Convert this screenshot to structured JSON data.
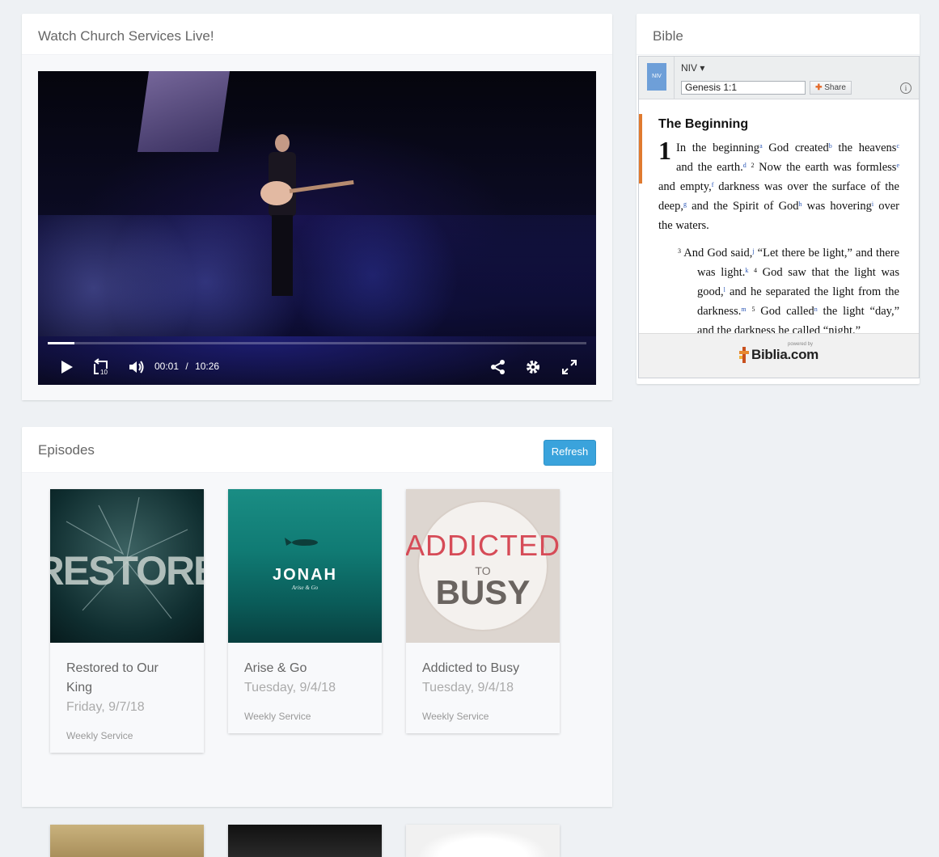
{
  "video_panel": {
    "title": "Watch Church Services Live!",
    "progress": 0.05,
    "current_time": "00:01",
    "separator": "/",
    "duration": "10:26",
    "rewind_label": "10"
  },
  "bible_panel": {
    "title": "Bible",
    "logo_label": "NIV",
    "version": "NIV ▾",
    "reference": "Genesis 1:1",
    "share_label": "Share",
    "info_label": "i",
    "heading": "The Beginning",
    "chapter": "1",
    "powered_by": "powered by",
    "brand": "Biblia.com"
  },
  "episodes_panel": {
    "title": "Episodes",
    "refresh_label": "Refresh",
    "cards": [
      {
        "title": "Restored to Our King",
        "date": "Friday, 9/7/18",
        "type": "Weekly Service",
        "art": "RESTORE"
      },
      {
        "title": "Arise & Go",
        "date": "Tuesday, 9/4/18",
        "type": "Weekly Service",
        "art": "JONAH",
        "art_sub": "Arise & Go"
      },
      {
        "title": "Addicted to Busy",
        "date": "Tuesday, 9/4/18",
        "type": "Weekly Service",
        "art": "ADDICTED",
        "art_to": "TO",
        "art_busy": "BUSY"
      }
    ]
  },
  "colors": {
    "accent_blue": "#3aa3dc",
    "bible_accent": "#e07a2f",
    "page_bg": "#eef1f4"
  }
}
